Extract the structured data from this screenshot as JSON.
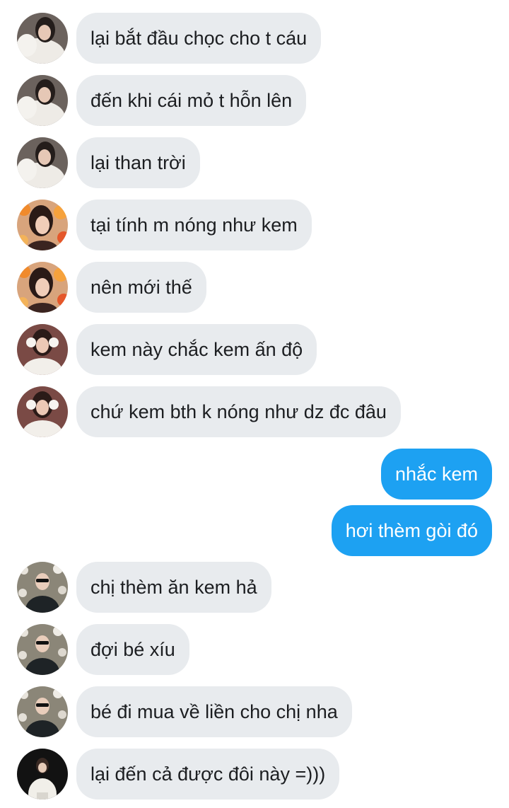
{
  "messages": [
    {
      "direction": "incoming",
      "avatar": "avatar-fur-coat-woman",
      "text": "lại bắt đầu chọc cho t cáu"
    },
    {
      "direction": "incoming",
      "avatar": "avatar-fur-coat-woman",
      "text": "đến khi cái mỏ t hỗn lên"
    },
    {
      "direction": "incoming",
      "avatar": "avatar-fur-coat-woman",
      "text": "lại than trời"
    },
    {
      "direction": "incoming",
      "avatar": "avatar-woman-flowers",
      "text": "tại tính m nóng như kem"
    },
    {
      "direction": "incoming",
      "avatar": "avatar-woman-flowers",
      "text": "nên mới thế"
    },
    {
      "direction": "incoming",
      "avatar": "avatar-woman-earmuffs",
      "text": "kem này chắc kem ấn độ"
    },
    {
      "direction": "incoming",
      "avatar": "avatar-woman-earmuffs",
      "text": "chứ kem bth k nóng như dz đc đâu"
    },
    {
      "direction": "outgoing",
      "avatar": null,
      "text": "nhắc kem"
    },
    {
      "direction": "outgoing",
      "avatar": null,
      "text": "hơi thèm gòi đó"
    },
    {
      "direction": "incoming",
      "avatar": "avatar-woman-sunglasses-blossoms",
      "text": "chị thèm ăn kem hả"
    },
    {
      "direction": "incoming",
      "avatar": "avatar-woman-sunglasses-blossoms",
      "text": "đợi bé xíu"
    },
    {
      "direction": "incoming",
      "avatar": "avatar-woman-sunglasses-blossoms",
      "text": "bé đi mua về liền cho chị nha"
    },
    {
      "direction": "incoming",
      "avatar": "avatar-woman-white-coat-dark",
      "text": "lại đến cả được đôi này =)))"
    }
  ],
  "colors": {
    "incoming_bubble": "#e8ebee",
    "incoming_text": "#1c1e21",
    "outgoing_bubble": "#1da1f2",
    "outgoing_text": "#ffffff"
  }
}
